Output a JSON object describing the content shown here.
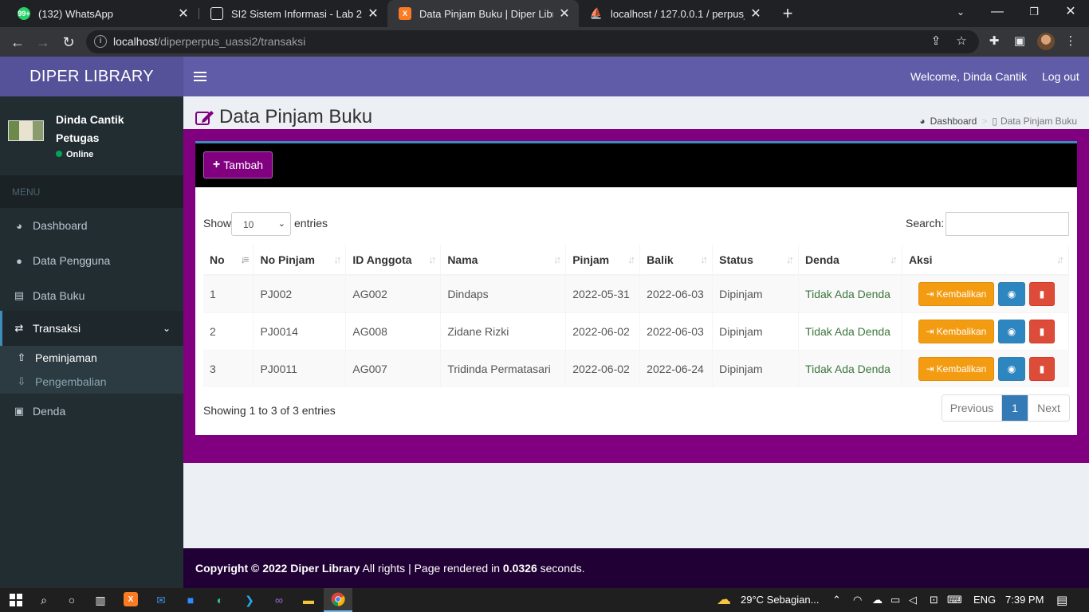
{
  "browser": {
    "tabs": [
      {
        "title": "(132) WhatsApp",
        "favicon": "whatsapp-icon",
        "badge": "99+"
      },
      {
        "title": "SI2 Sistem Informasi - Lab 2",
        "favicon": "classroom-icon"
      },
      {
        "title": "Data Pinjam Buku | Diper Library",
        "favicon": "xampp-icon"
      },
      {
        "title": "localhost / 127.0.0.1 / perpus_si2",
        "favicon": "phpmyadmin-icon"
      }
    ],
    "url_host": "localhost",
    "url_path": "/diperperpus_uassi2/transaksi"
  },
  "app": {
    "logo": "DIPER LIBRARY",
    "welcome": "Welcome, Dinda Cantik",
    "logout": "Log out",
    "user": {
      "name": "Dinda Cantik",
      "role": "Petugas",
      "status": "Online"
    },
    "menu_header": "MENU",
    "menu": [
      {
        "label": "Dashboard",
        "icon": "dashboard-icon"
      },
      {
        "label": "Data Pengguna",
        "icon": "user-icon"
      },
      {
        "label": "Data Buku",
        "icon": "book-icon"
      },
      {
        "label": "Transaksi",
        "icon": "exchange-icon"
      },
      {
        "label": "Denda",
        "icon": "money-icon"
      }
    ],
    "submenu": [
      {
        "label": "Peminjaman",
        "icon": "upload-icon"
      },
      {
        "label": "Pengembalian",
        "icon": "download-icon"
      }
    ]
  },
  "page": {
    "title": "Data Pinjam Buku",
    "breadcrumb": {
      "home": "Dashboard",
      "current": "Data Pinjam Buku"
    },
    "add_button": "Tambah",
    "show_label": "Show",
    "length_value": "10",
    "entries_label": "entries",
    "search_label": "Search:",
    "columns": [
      "No",
      "No Pinjam",
      "ID Anggota",
      "Nama",
      "Pinjam",
      "Balik",
      "Status",
      "Denda",
      "Aksi"
    ],
    "rows": [
      {
        "no": "1",
        "no_pinjam": "PJ002",
        "id_anggota": "AG002",
        "nama": "Dindaps",
        "pinjam": "2022-05-31",
        "balik": "2022-06-03",
        "status": "Dipinjam",
        "denda": "Tidak Ada Denda"
      },
      {
        "no": "2",
        "no_pinjam": "PJ0014",
        "id_anggota": "AG008",
        "nama": "Zidane Rizki",
        "pinjam": "2022-06-02",
        "balik": "2022-06-03",
        "status": "Dipinjam",
        "denda": "Tidak Ada Denda"
      },
      {
        "no": "3",
        "no_pinjam": "PJ0011",
        "id_anggota": "AG007",
        "nama": "Tridinda Permatasari",
        "pinjam": "2022-06-02",
        "balik": "2022-06-24",
        "status": "Dipinjam",
        "denda": "Tidak Ada Denda"
      }
    ],
    "return_button": "Kembalikan",
    "info": "Showing 1 to 3 of 3 entries",
    "pager": {
      "prev": "Previous",
      "page": "1",
      "next": "Next"
    }
  },
  "footer": {
    "copyright": "Copyright © 2022 Diper Library",
    "rights": " All rights | Page rendered in ",
    "time": "0.0326",
    "seconds": " seconds."
  },
  "taskbar": {
    "weather": "29°C  Sebagian...",
    "lang": "ENG",
    "time": "7:39 PM"
  },
  "colors": {
    "header": "#605ca8",
    "logo_bg": "#555299",
    "sidebar": "#222d32",
    "content_bg": "#800080",
    "footer": "#210035",
    "accent": "#3c8dbc"
  }
}
